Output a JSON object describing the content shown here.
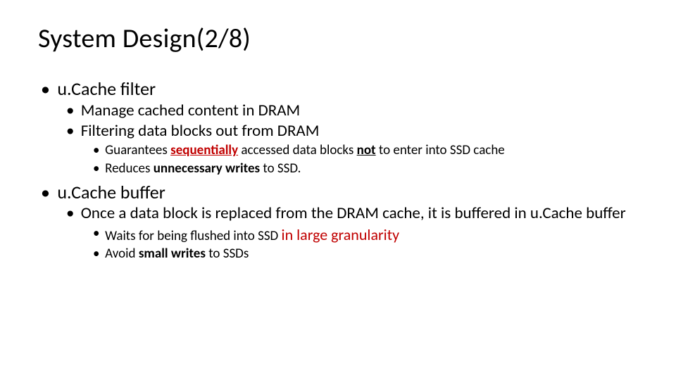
{
  "title": "System Design(2/8)",
  "points": {
    "filter": {
      "heading": "u.Cache filter",
      "sub1": "Manage cached content in DRAM",
      "sub2": "Filtering data blocks out from DRAM",
      "sub2a_pre": "Guarantees ",
      "sub2a_seq": "sequentially",
      "sub2a_mid": " accessed data blocks ",
      "sub2a_not": "not",
      "sub2a_post": " to enter into SSD cache",
      "sub2b_pre": "Reduces ",
      "sub2b_bold": "unnecessary writes",
      "sub2b_post": " to SSD."
    },
    "buffer": {
      "heading": "u.Cache buffer",
      "sub1": "Once a data block is replaced from the DRAM cache, it is buffered in u.Cache buffer",
      "sub1a_pre": "Waits for being flushed into SSD  ",
      "sub1a_accent": "in large granularity",
      "sub1b_pre": "Avoid ",
      "sub1b_bold": "small writes",
      "sub1b_post": " to SSDs"
    }
  }
}
